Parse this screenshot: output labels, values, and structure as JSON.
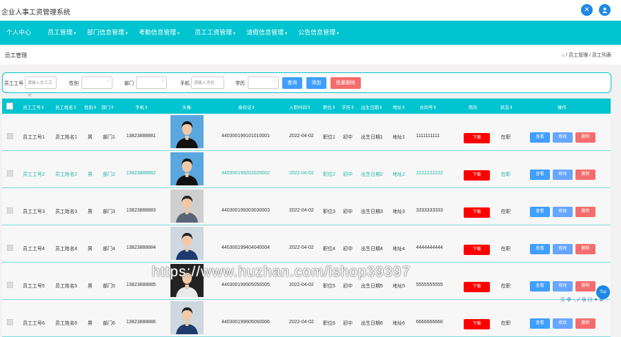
{
  "app": {
    "title": "企业人事工资管理系统"
  },
  "top_icons": [
    {
      "name": "fullscreen-icon",
      "glyph": "✕"
    },
    {
      "name": "user-icon",
      "glyph": "●"
    }
  ],
  "nav": [
    {
      "label": "个人中心",
      "caret": ""
    },
    {
      "label": "员工管理",
      "caret": "▾"
    },
    {
      "label": "部门信息管理",
      "caret": "▾"
    },
    {
      "label": "考勤信息管理",
      "caret": "▾"
    },
    {
      "label": "员工工资管理",
      "caret": "▾"
    },
    {
      "label": "请假信息管理",
      "caret": "▾"
    },
    {
      "label": "公告信息管理",
      "caret": "▾"
    }
  ],
  "breadcrumb": {
    "title": "员工管理",
    "path": "⌂ / 员工管理 / 员工列表"
  },
  "filters": {
    "employee_no": {
      "label": "员工工号",
      "placeholder": "请输入员工工号"
    },
    "gender": {
      "label": "性别"
    },
    "department": {
      "label": "部门"
    },
    "phone": {
      "label": "手机",
      "placeholder": "请输入手机"
    },
    "education": {
      "label": "学历"
    },
    "buttons": {
      "search": "查询",
      "add": "添加",
      "batch_delete": "批量删除"
    }
  },
  "colors": {
    "accent": "#00c4cf",
    "primary": "#409eff",
    "danger": "#f56c6c",
    "download": "#ff0000"
  },
  "table": {
    "headers": [
      "员工工号⇕",
      "员工姓名⇕",
      "性别⇕",
      "部门⇕",
      "手机⇕",
      "头像",
      "身份证⇕",
      "入职时间⇕",
      "职位⇕",
      "学历⇕",
      "出生日期⇕",
      "地址⇕",
      "合同号⇕",
      "简历",
      "状态⇕",
      "操作"
    ],
    "rows": [
      {
        "no": "员工工号1",
        "name": "员工姓名1",
        "gender": "男",
        "dept": "部门1",
        "phone": "13823888881",
        "idcard": "440300199101010001",
        "join": "2022-04-02",
        "position": "职位1",
        "edu": "初中",
        "birth": "出生日期1",
        "addr": "地址1",
        "contract": "1111111111",
        "resume": "下载",
        "status": "在职",
        "photo": "woman"
      },
      {
        "no": "员工工号2",
        "name": "员工姓名2",
        "gender": "男",
        "dept": "部门2",
        "phone": "13823888882",
        "idcard": "440300199202020002",
        "join": "2022-04-02",
        "position": "职位2",
        "edu": "初中",
        "birth": "出生日期2",
        "addr": "地址2",
        "contract": "2222222222",
        "resume": "下载",
        "status": "在职",
        "photo": "woman"
      },
      {
        "no": "员工工号3",
        "name": "员工姓名3",
        "gender": "男",
        "dept": "部门3",
        "phone": "13823888883",
        "idcard": "440300199303030003",
        "join": "2022-04-02",
        "position": "职位3",
        "edu": "初中",
        "birth": "出生日期3",
        "addr": "地址3",
        "contract": "3333333333",
        "resume": "下载",
        "status": "在职",
        "photo": "man-grey"
      },
      {
        "no": "员工工号4",
        "name": "员工姓名4",
        "gender": "男",
        "dept": "部门4",
        "phone": "13823888884",
        "idcard": "440300199404040004",
        "join": "2022-04-02",
        "position": "职位4",
        "edu": "初中",
        "birth": "出生日期4",
        "addr": "地址4",
        "contract": "4444444444",
        "resume": "下载",
        "status": "在职",
        "photo": "man-blue"
      },
      {
        "no": "员工工号5",
        "name": "员工姓名5",
        "gender": "男",
        "dept": "部门5",
        "phone": "13823888885",
        "idcard": "440300199505050005",
        "join": "2022-04-02",
        "position": "职位5",
        "edu": "初中",
        "birth": "出生日期5",
        "addr": "地址5",
        "contract": "5555555555",
        "resume": "下载",
        "status": "在职",
        "photo": "man-dark"
      },
      {
        "no": "员工工号6",
        "name": "员工姓名6",
        "gender": "男",
        "dept": "部门6",
        "phone": "13823888886",
        "idcard": "440300199606060006",
        "join": "2022-04-02",
        "position": "职位6",
        "edu": "初中",
        "birth": "出生日期6",
        "addr": "地址6",
        "contract": "6666666666",
        "resume": "下载",
        "status": "在职",
        "photo": "man-blue"
      }
    ],
    "actions": {
      "view": "查看",
      "edit": "修改",
      "delete": "删除"
    }
  },
  "watermark": "https://www.huzhan.com/ishop39397",
  "back_to_top": "Top",
  "tray": "Ⓢ 中 ·, ✓ ⊕ ▤ ✦ ⚙"
}
